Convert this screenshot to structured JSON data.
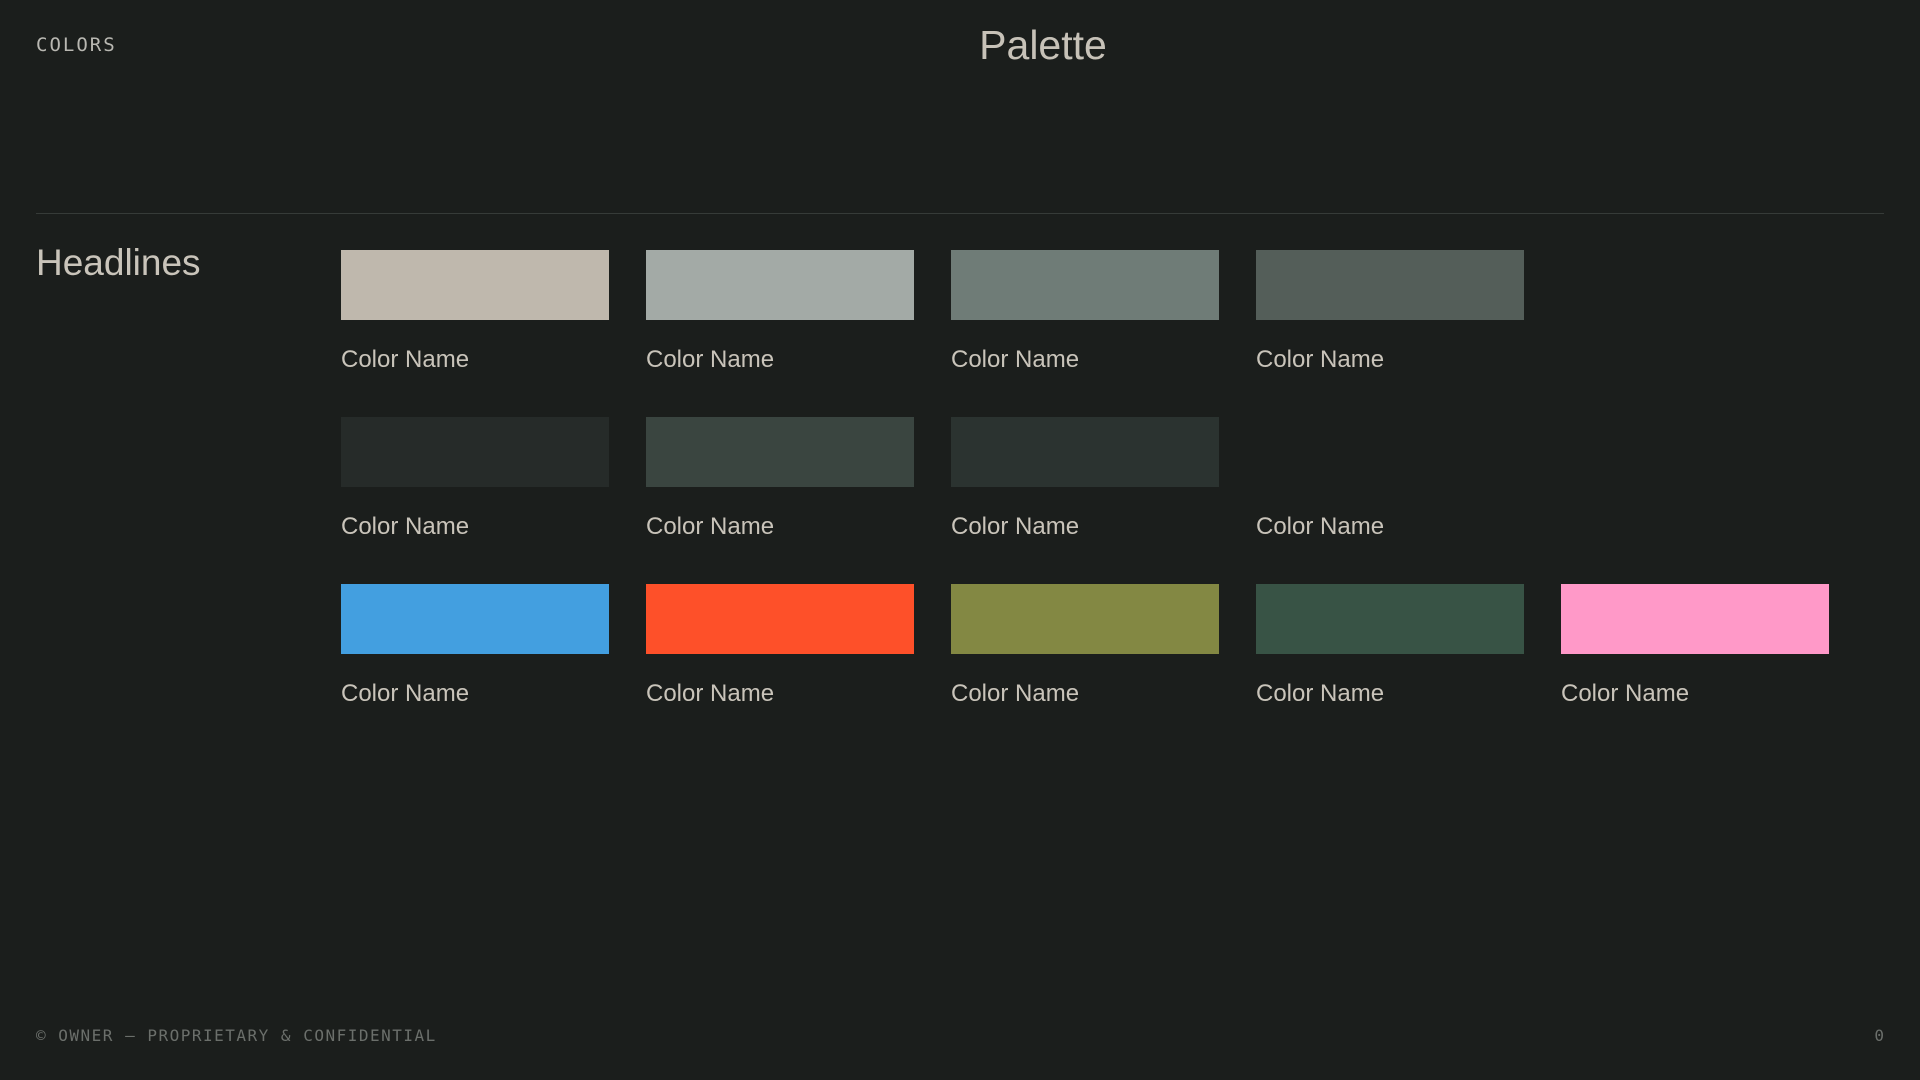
{
  "header": {
    "section_label": "COLORS",
    "title": "Palette"
  },
  "group": {
    "heading": "Headlines"
  },
  "swatches": [
    {
      "name": "Color Name",
      "color": "#bfb8ad"
    },
    {
      "name": "Color Name",
      "color": "#a3aaa6"
    },
    {
      "name": "Color Name",
      "color": "#6f7c77"
    },
    {
      "name": "Color Name",
      "color": "#545e59"
    },
    {
      "name": "",
      "color": ""
    },
    {
      "name": "Color Name",
      "color": "#262b29"
    },
    {
      "name": "Color Name",
      "color": "#3a4540"
    },
    {
      "name": "Color Name",
      "color": "#2b3330"
    },
    {
      "name": "Color Name",
      "color": "#1b1e1c"
    },
    {
      "name": "",
      "color": ""
    },
    {
      "name": "Color Name",
      "color": "#439fe0"
    },
    {
      "name": "Color Name",
      "color": "#fe5029"
    },
    {
      "name": "Color Name",
      "color": "#838843"
    },
    {
      "name": "Color Name",
      "color": "#385345"
    },
    {
      "name": "Color Name",
      "color": "#ff99c8"
    }
  ],
  "footer": {
    "note": "© OWNER — PROPRIETARY & CONFIDENTIAL",
    "page_number": "0"
  }
}
